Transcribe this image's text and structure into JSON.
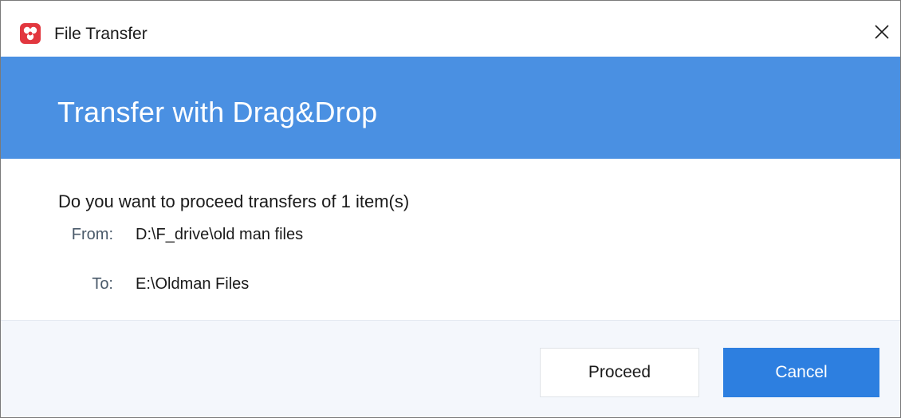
{
  "window": {
    "title": "File Transfer",
    "close_icon": "close-icon",
    "app_icon": "app-logo-icon"
  },
  "banner": {
    "title": "Transfer with Drag&Drop"
  },
  "message": {
    "question": "Do you want to proceed transfers of 1 item(s)",
    "from_label": "From:",
    "from_value": "D:\\F_drive\\old man files",
    "to_label": "To:",
    "to_value": "E:\\Oldman Files"
  },
  "buttons": {
    "proceed_label": "Proceed",
    "cancel_label": "Cancel"
  },
  "colors": {
    "accent": "#4a90e2",
    "primary_button": "#2d7fe0",
    "app_icon": "#e2373f",
    "footer_bg": "#f4f7fc"
  }
}
